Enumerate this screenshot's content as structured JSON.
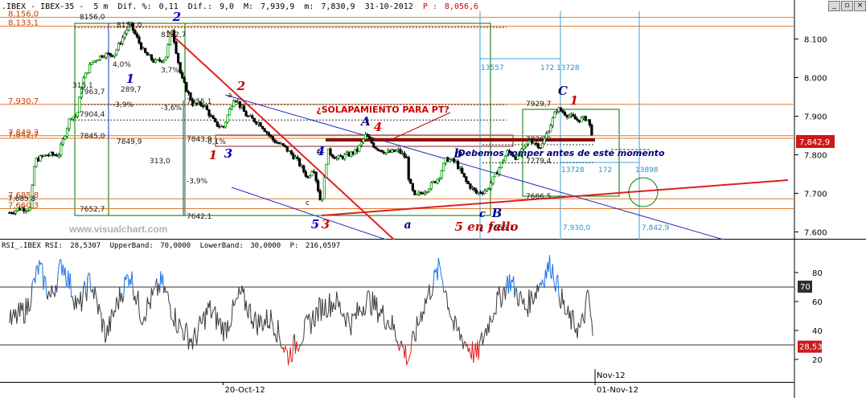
{
  "header": {
    "symbol": ".IBEX - IBEX-35 -",
    "interval": "5 m",
    "diff_pct_label": "Dif. %:",
    "diff_pct": "0,11",
    "diff_label": "Dif.:",
    "diff": "9,0",
    "max_label": "M:",
    "max": "7,939,9",
    "min_label": "m:",
    "min": "7,830,9",
    "date": "31-10-2012",
    "price_label": "P :",
    "price": "8,056,6",
    "price_color": "#cc0000"
  },
  "rsi_header": {
    "name": "RSI_.IBEX RSI:",
    "value": "28,5307",
    "upper_label": "UpperBand:",
    "upper": "70,0000",
    "lower_label": "LowerBand:",
    "lower": "30,0000",
    "p_label": "P:",
    "p": "216,0597"
  },
  "window_buttons": {
    "minimize": "_",
    "restore": "▫",
    "close": "×"
  },
  "watermark": "www.visualchart.com",
  "current_price": "7,842,9",
  "rsi_current": "28,53",
  "chart_data": [
    {
      "type": "candlestick",
      "title": "IBEX-35 5 m",
      "y_axis_ticks": [
        7600,
        7700,
        7800,
        7900,
        8000,
        8100
      ],
      "y_axis_tick_labels": [
        "7.600",
        "7.700",
        "7.800",
        "7.900",
        "8.000",
        "8.100"
      ],
      "ylim": [
        7580,
        8172
      ],
      "x_range_bars": [
        0,
        1000
      ],
      "x_axis_labels": [
        {
          "bar": 278,
          "label": "20-Oct-12"
        },
        {
          "bar": 748,
          "label": "01-Nov-12"
        },
        {
          "bar": 748,
          "label": "Nov-12"
        }
      ],
      "price_path": [
        {
          "bar": 8,
          "price": 7650
        },
        {
          "bar": 20,
          "price": 7660
        },
        {
          "bar": 34,
          "price": 7660
        },
        {
          "bar": 40,
          "price": 7785
        },
        {
          "bar": 55,
          "price": 7800
        },
        {
          "bar": 70,
          "price": 7800
        },
        {
          "bar": 85,
          "price": 7900
        },
        {
          "bar": 93,
          "price": 7900
        },
        {
          "bar": 100,
          "price": 7990
        },
        {
          "bar": 112,
          "price": 8040
        },
        {
          "bar": 126,
          "price": 8060
        },
        {
          "bar": 140,
          "price": 8060
        },
        {
          "bar": 160,
          "price": 8140
        },
        {
          "bar": 178,
          "price": 8065
        },
        {
          "bar": 192,
          "price": 8040
        },
        {
          "bar": 205,
          "price": 8050
        },
        {
          "bar": 213,
          "price": 8130
        },
        {
          "bar": 225,
          "price": 8000
        },
        {
          "bar": 240,
          "price": 7930
        },
        {
          "bar": 253,
          "price": 7930
        },
        {
          "bar": 268,
          "price": 7880
        },
        {
          "bar": 278,
          "price": 7870
        },
        {
          "bar": 292,
          "price": 7950
        },
        {
          "bar": 308,
          "price": 7900
        },
        {
          "bar": 325,
          "price": 7880
        },
        {
          "bar": 340,
          "price": 7840
        },
        {
          "bar": 355,
          "price": 7820
        },
        {
          "bar": 370,
          "price": 7790
        },
        {
          "bar": 385,
          "price": 7740
        },
        {
          "bar": 392,
          "price": 7770
        },
        {
          "bar": 402,
          "price": 7670
        },
        {
          "bar": 410,
          "price": 7810
        },
        {
          "bar": 422,
          "price": 7790
        },
        {
          "bar": 436,
          "price": 7800
        },
        {
          "bar": 447,
          "price": 7810
        },
        {
          "bar": 458,
          "price": 7850
        },
        {
          "bar": 470,
          "price": 7820
        },
        {
          "bar": 485,
          "price": 7805
        },
        {
          "bar": 500,
          "price": 7810
        },
        {
          "bar": 510,
          "price": 7790
        },
        {
          "bar": 513,
          "price": 7730
        },
        {
          "bar": 520,
          "price": 7690
        },
        {
          "bar": 535,
          "price": 7710
        },
        {
          "bar": 550,
          "price": 7740
        },
        {
          "bar": 560,
          "price": 7790
        },
        {
          "bar": 572,
          "price": 7780
        },
        {
          "bar": 585,
          "price": 7730
        },
        {
          "bar": 598,
          "price": 7700
        },
        {
          "bar": 612,
          "price": 7710
        },
        {
          "bar": 625,
          "price": 7760
        },
        {
          "bar": 638,
          "price": 7810
        },
        {
          "bar": 650,
          "price": 7790
        },
        {
          "bar": 665,
          "price": 7840
        },
        {
          "bar": 680,
          "price": 7820
        },
        {
          "bar": 690,
          "price": 7870
        },
        {
          "bar": 700,
          "price": 7920
        },
        {
          "bar": 712,
          "price": 7905
        },
        {
          "bar": 725,
          "price": 7890
        },
        {
          "bar": 738,
          "price": 7895
        },
        {
          "bar": 746,
          "price": 7843
        }
      ],
      "annotations": [
        {
          "text": "1",
          "color": "#0000cc"
        },
        {
          "text": "2",
          "color": "#0000cc"
        },
        {
          "text": "3",
          "color": "#0000cc"
        },
        {
          "text": "4",
          "color": "#0000cc"
        },
        {
          "text": "5",
          "color": "#0000cc"
        },
        {
          "text": "1",
          "color": "#cc0000"
        },
        {
          "text": "2",
          "color": "#cc0000"
        },
        {
          "text": "3",
          "color": "#cc0000"
        },
        {
          "text": "4",
          "color": "#cc0000"
        },
        {
          "text": "A",
          "color": "#000080"
        },
        {
          "text": "b",
          "color": "#000080"
        },
        {
          "text": "a",
          "color": "#000080"
        },
        {
          "text": "c",
          "color": "#000080"
        },
        {
          "text": "B",
          "color": "#000080"
        },
        {
          "text": "C",
          "color": "#000080"
        },
        {
          "text": "1",
          "color": "#cc0000"
        },
        {
          "text": "5 en fallo",
          "color": "#cc0000"
        },
        {
          "text": "¿SOLAPAMIENTO PARA PT?",
          "color": "#cc0000"
        },
        {
          "text": "Debemos romper antes de este momento",
          "color": "#000080"
        }
      ],
      "horizontal_levels": [
        {
          "price": 8156.0,
          "label": "8,156,0"
        },
        {
          "price": 8133.1,
          "label": "8,133,1"
        },
        {
          "price": 7930.7,
          "label": "7,930,7"
        },
        {
          "price": 7849.3,
          "label": "7,849,3"
        },
        {
          "price": 7842.7,
          "label": "7,842,7"
        },
        {
          "price": 7685.8,
          "label": "7,685,8"
        },
        {
          "price": 7660.3,
          "label": "7,660,3"
        }
      ],
      "price_labels": [
        "8156,0",
        "8156,0",
        "8132,7",
        "7963,7",
        "7955,1",
        "7904,4",
        "7849,9",
        "7843,9",
        "7845,0",
        "7652,7",
        "7642,1",
        "7929,7",
        "7826,0",
        "7779,4",
        "7686,5",
        "7,930,0",
        "7,842,9",
        "7,685,8",
        "315,1",
        "289,7",
        "313,0",
        "-3,9%",
        "-3,6%",
        "-3,9%",
        "4,0%",
        "3,7%",
        "0,1%",
        "13557",
        "172",
        "13728",
        "13728",
        "172",
        "13898",
        "a",
        "b",
        "c",
        "c",
        "7656,1"
      ]
    },
    {
      "type": "line",
      "title": "RSI_.IBEX RSI",
      "y_axis_ticks": [
        20,
        40,
        60,
        80
      ],
      "ylim": [
        15,
        95
      ],
      "upper_band": 70,
      "lower_band": 30,
      "labels": [
        "70",
        "28,53"
      ],
      "anchors": [
        {
          "bar": 8,
          "value": 45
        },
        {
          "bar": 30,
          "value": 55
        },
        {
          "bar": 45,
          "value": 84
        },
        {
          "bar": 60,
          "value": 62
        },
        {
          "bar": 75,
          "value": 87
        },
        {
          "bar": 95,
          "value": 55
        },
        {
          "bar": 110,
          "value": 75
        },
        {
          "bar": 130,
          "value": 36
        },
        {
          "bar": 145,
          "value": 60
        },
        {
          "bar": 160,
          "value": 80
        },
        {
          "bar": 175,
          "value": 50
        },
        {
          "bar": 200,
          "value": 73
        },
        {
          "bar": 220,
          "value": 45
        },
        {
          "bar": 240,
          "value": 32
        },
        {
          "bar": 260,
          "value": 55
        },
        {
          "bar": 280,
          "value": 40
        },
        {
          "bar": 300,
          "value": 65
        },
        {
          "bar": 320,
          "value": 45
        },
        {
          "bar": 340,
          "value": 48
        },
        {
          "bar": 360,
          "value": 22
        },
        {
          "bar": 375,
          "value": 35
        },
        {
          "bar": 400,
          "value": 55
        },
        {
          "bar": 420,
          "value": 60
        },
        {
          "bar": 440,
          "value": 45
        },
        {
          "bar": 460,
          "value": 62
        },
        {
          "bar": 490,
          "value": 45
        },
        {
          "bar": 512,
          "value": 20
        },
        {
          "bar": 530,
          "value": 55
        },
        {
          "bar": 552,
          "value": 84
        },
        {
          "bar": 570,
          "value": 42
        },
        {
          "bar": 598,
          "value": 22
        },
        {
          "bar": 620,
          "value": 55
        },
        {
          "bar": 640,
          "value": 75
        },
        {
          "bar": 660,
          "value": 55
        },
        {
          "bar": 692,
          "value": 86
        },
        {
          "bar": 712,
          "value": 50
        },
        {
          "bar": 730,
          "value": 40
        },
        {
          "bar": 740,
          "value": 65
        },
        {
          "bar": 746,
          "value": 28
        }
      ]
    }
  ]
}
